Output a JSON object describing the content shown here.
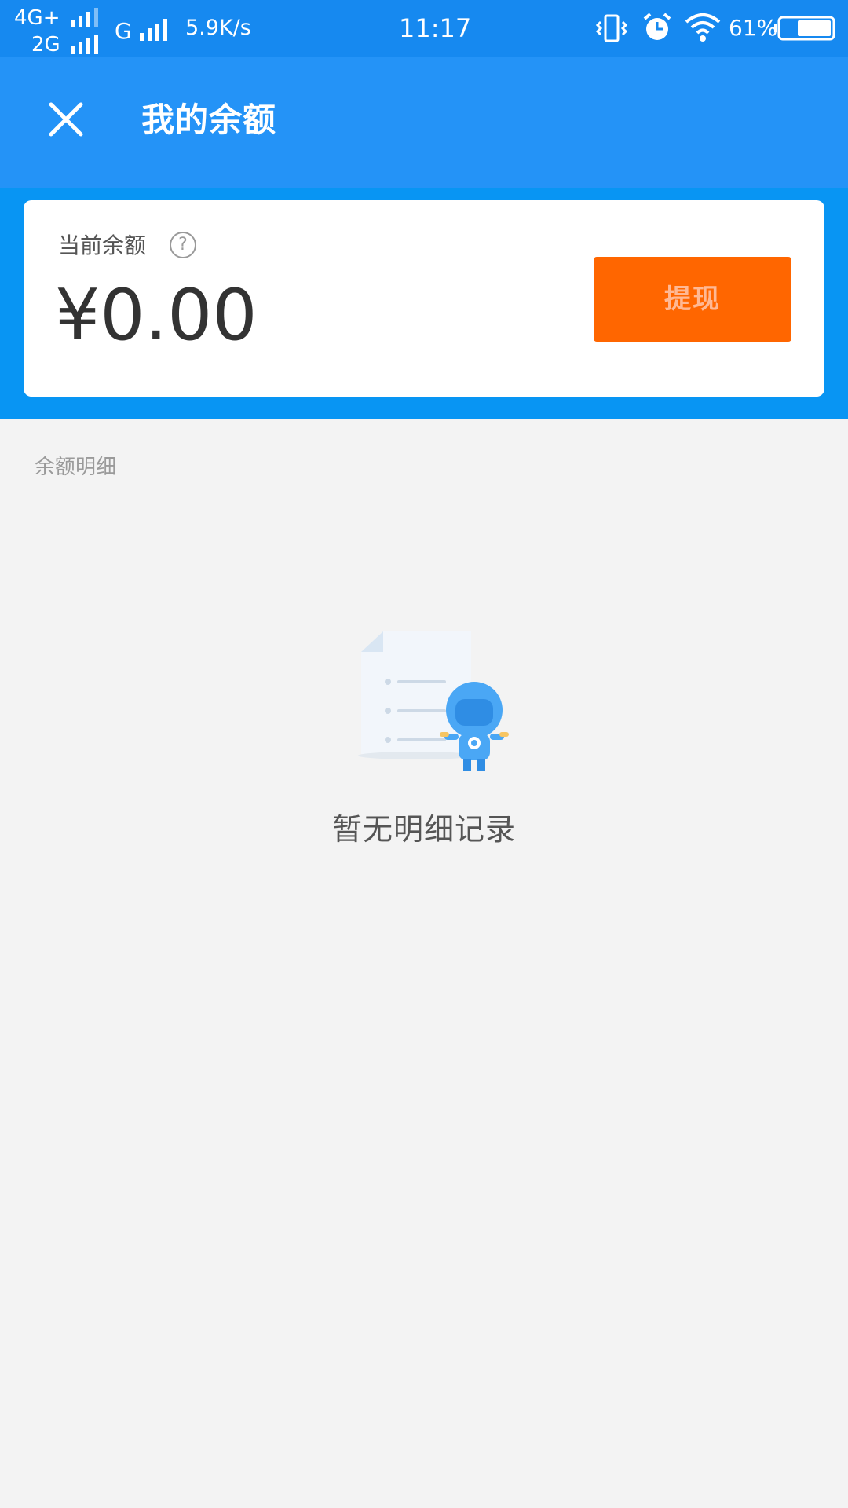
{
  "status_bar": {
    "network_top": "4G+",
    "network_bottom": "2G",
    "network_g": "G",
    "speed": "5.9K/s",
    "time": "11:17",
    "battery": "61%",
    "icons": [
      "vibrate-icon",
      "alarm-icon",
      "wifi-icon",
      "battery-icon"
    ]
  },
  "header": {
    "title": "我的余额",
    "close_icon": "close-icon",
    "background": "#2493f7"
  },
  "balance": {
    "label": "当前余额",
    "help_glyph": "?",
    "amount": "¥0.00",
    "withdraw_label": "提现",
    "withdraw_color": "#ff6600"
  },
  "details": {
    "title": "余额明细",
    "empty_text": "暂无明细记录",
    "illustration": "empty-records-mascot-icon"
  }
}
